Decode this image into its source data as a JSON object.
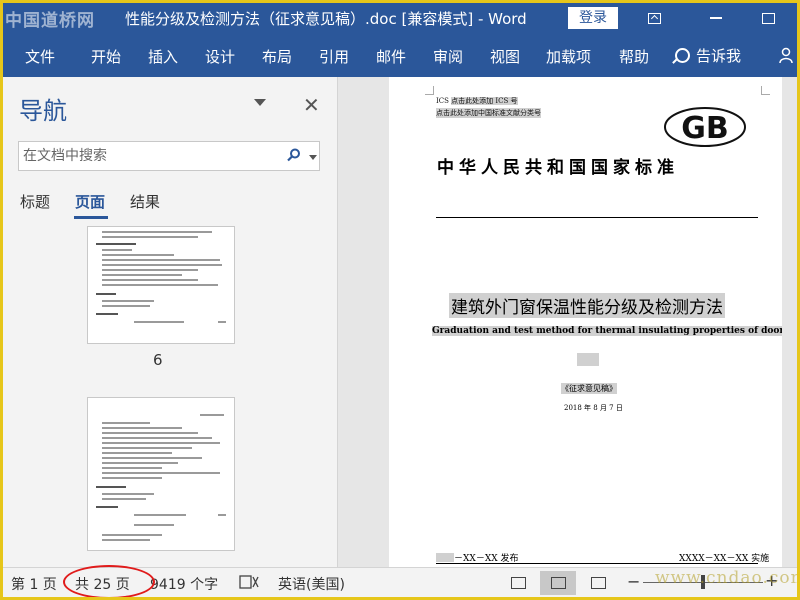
{
  "watermark": "中国道桥网",
  "title_bar": {
    "document_title": "性能分级及检测方法（征求意见稿）.doc [兼容模式]  -  Word",
    "login_label": "登录"
  },
  "ribbon": {
    "tabs": [
      "文件",
      "开始",
      "插入",
      "设计",
      "布局",
      "引用",
      "邮件",
      "审阅",
      "视图",
      "加载项",
      "帮助"
    ],
    "tell_me": "告诉我"
  },
  "nav_pane": {
    "title": "导航",
    "search_placeholder": "在文档中搜索",
    "tabs": [
      "标题",
      "页面",
      "结果"
    ],
    "active_tab": "页面",
    "thumbnail_page_number": "6"
  },
  "document": {
    "ics_label": "ICS",
    "ics_placeholder": "点击此处添加 ICS 号",
    "classification_placeholder": "点击此处添加中国标准文献分类号",
    "logo_text": "GB",
    "standard_name": "中华人民共和国国家标准",
    "title_cn": "建筑外门窗保温性能分级及检测方法",
    "title_en": "Graduation and test method for thermal insulating properties of doors and windows",
    "draft_label": "《征求意见稿》",
    "date": "2018 年 8 月 7 日",
    "issue_text": "－XX－XX 发布",
    "implement_text": "XXXX－XX－XX 实施"
  },
  "status_bar": {
    "page": "第 1 页",
    "total_pages": "共 25 页",
    "word_count": "9419 个字",
    "language": "英语(美国)"
  },
  "footer_watermark": "www.cndao.com",
  "colors": {
    "word_blue": "#2b579a",
    "outer_frame": "#e6c61a",
    "annotation_red": "#e01b1b"
  }
}
